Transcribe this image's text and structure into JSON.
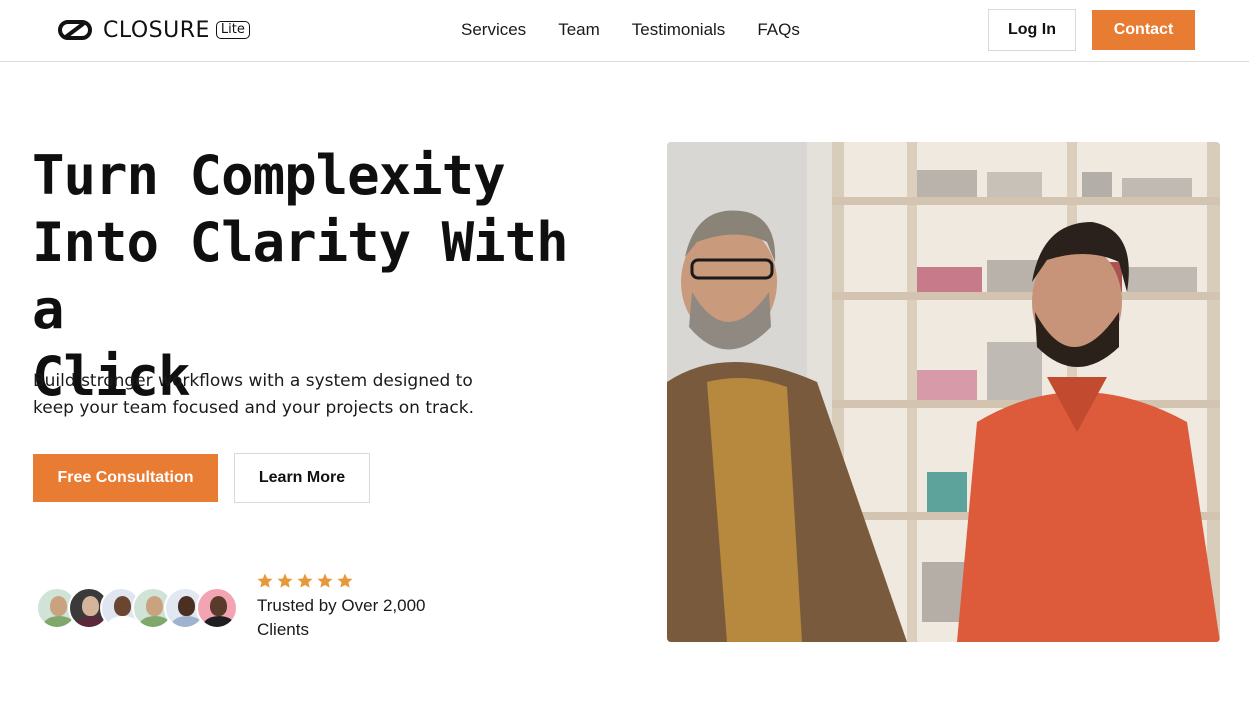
{
  "brand": {
    "name": "CLOSURE",
    "badge": "Lite"
  },
  "nav": {
    "links": [
      "Services",
      "Team",
      "Testimonials",
      "FAQs"
    ],
    "login_label": "Log In",
    "contact_label": "Contact"
  },
  "hero": {
    "headline_line1": "Turn Complexity",
    "headline_line2": "Into Clarity With a",
    "headline_line3": "Click",
    "subtext_line1": "Build stronger workflows with a system designed to",
    "subtext_line2": "keep your team focused and your projects on track.",
    "primary_cta": "Free Consultation",
    "secondary_cta": "Learn More"
  },
  "social_proof": {
    "rating_stars": 5,
    "trusted_line1": "Trusted by Over 2,000",
    "trusted_line2": "Clients",
    "avatar_count": 6
  },
  "colors": {
    "accent": "#e97c33",
    "star": "#e8973a",
    "text": "#111111"
  },
  "icons": [
    "closure-logo-icon",
    "star-icon"
  ]
}
